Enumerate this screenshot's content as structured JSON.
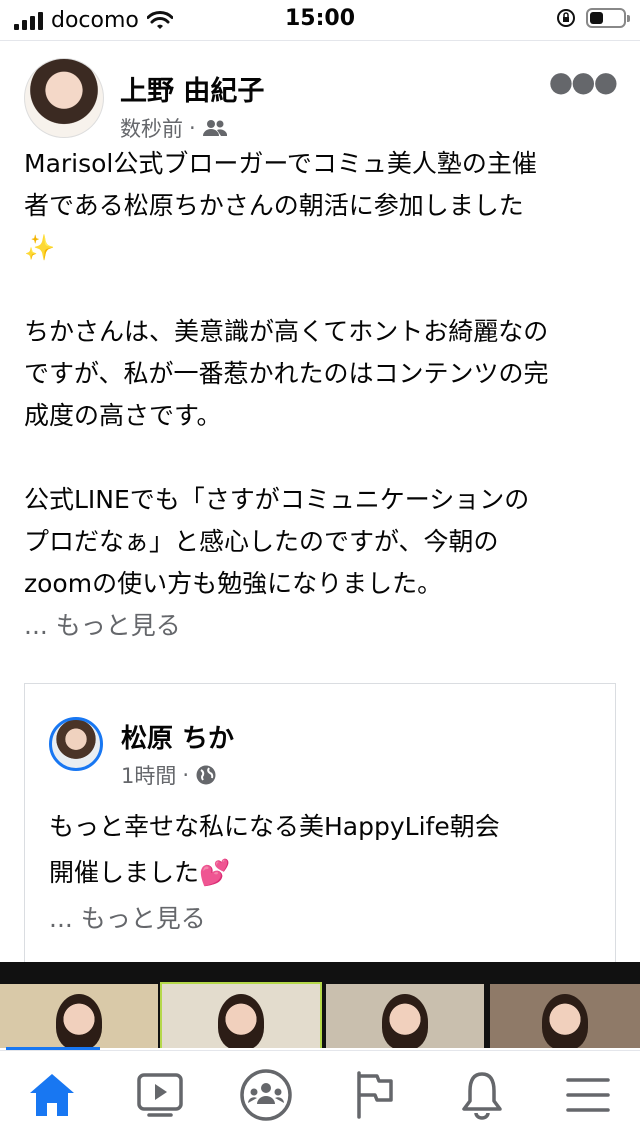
{
  "status_bar": {
    "carrier": "docomo",
    "time": "15:00",
    "battery_level": 0.4
  },
  "post": {
    "author": "上野 由紀子",
    "timestamp": "数秒前",
    "privacy_icon": "friends-icon",
    "lines": [
      "Marisol公式ブローガーでコミュ美人塾の主催",
      "者である松原ちかさんの朝活に参加しました",
      "✨",
      "",
      "ちかさんは、美意識が高くてホントお綺麗なの",
      "ですが、私が一番惹かれたのはコンテンツの完",
      "成度の高さです。",
      "",
      "公式LINEでも「さすがコミュニケーションの",
      "プロだなぁ」と感心したのですが、今朝の",
      "zoomの使い方も勉強になりました。"
    ],
    "see_more": "... もっと見る"
  },
  "shared_post": {
    "author": "松原 ちか",
    "timestamp": "1時間",
    "privacy_icon": "globe-icon",
    "lines": [
      "もっと幸せな私になる美HappyLife朝会",
      "開催しました💕"
    ],
    "see_more": "... もっと見る"
  },
  "tab_bar": {
    "tabs": [
      {
        "name": "home",
        "icon": "home-icon",
        "active": true
      },
      {
        "name": "watch",
        "icon": "video-icon"
      },
      {
        "name": "groups",
        "icon": "groups-icon"
      },
      {
        "name": "pages",
        "icon": "flag-icon"
      },
      {
        "name": "notifications",
        "icon": "bell-icon"
      },
      {
        "name": "menu",
        "icon": "menu-icon"
      }
    ]
  },
  "colors": {
    "accent": "#1877f2",
    "text": "#050505",
    "secondary": "#65676b"
  }
}
